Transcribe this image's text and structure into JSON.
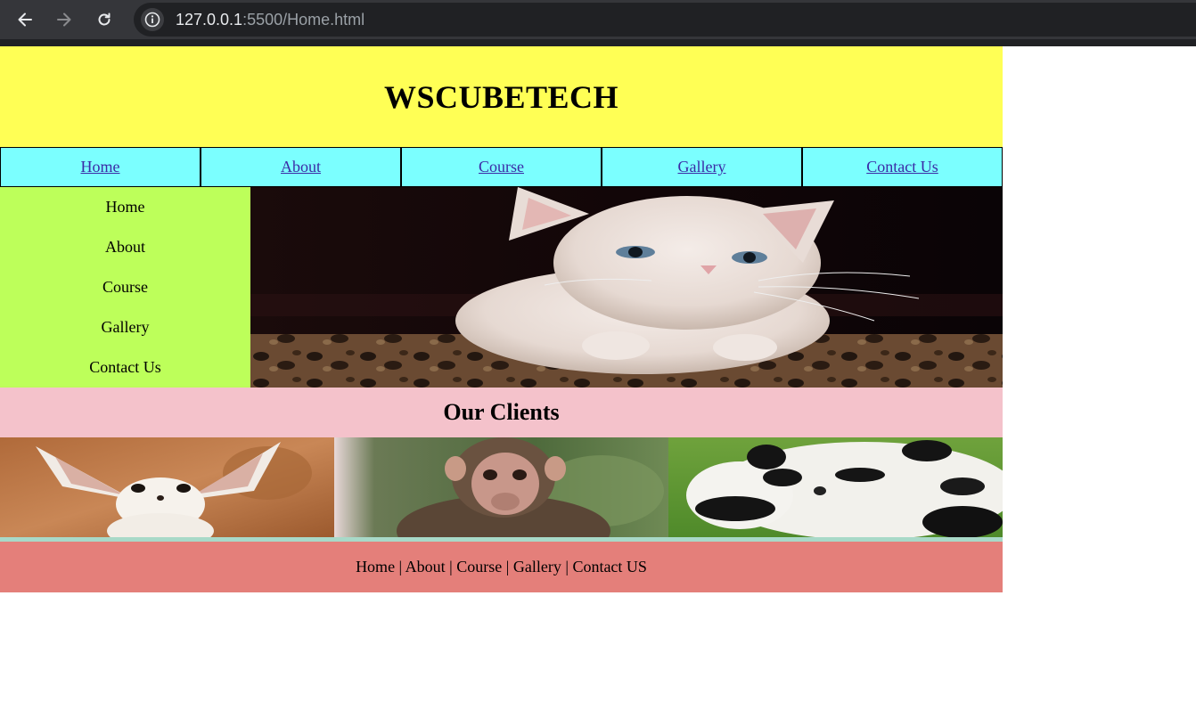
{
  "browser": {
    "url_host": "127.0.0.1",
    "url_rest": ":5500/Home.html",
    "icons": {
      "back": "arrow-left-icon",
      "forward": "arrow-right-icon",
      "reload": "reload-icon",
      "info": "info-icon"
    }
  },
  "header": {
    "title": "WSCUBETECH"
  },
  "topnav": {
    "items": [
      {
        "label": "Home"
      },
      {
        "label": "About"
      },
      {
        "label": "Course"
      },
      {
        "label": "Gallery"
      },
      {
        "label": "Contact Us"
      }
    ]
  },
  "sidebar": {
    "items": [
      {
        "label": "Home"
      },
      {
        "label": "About"
      },
      {
        "label": "Course"
      },
      {
        "label": "Gallery"
      },
      {
        "label": "Contact Us"
      }
    ]
  },
  "clients": {
    "heading": "Our Clients"
  },
  "footer": {
    "text": "Home | About | Course | Gallery | Contact US"
  },
  "colors": {
    "header_bg": "#ffff55",
    "nav_bg": "#7bffff",
    "sidebar_bg": "#bdff5a",
    "clients_bg": "#f4c2cb",
    "footer_bg": "#e47f7a",
    "link": "#3b2aa6"
  }
}
